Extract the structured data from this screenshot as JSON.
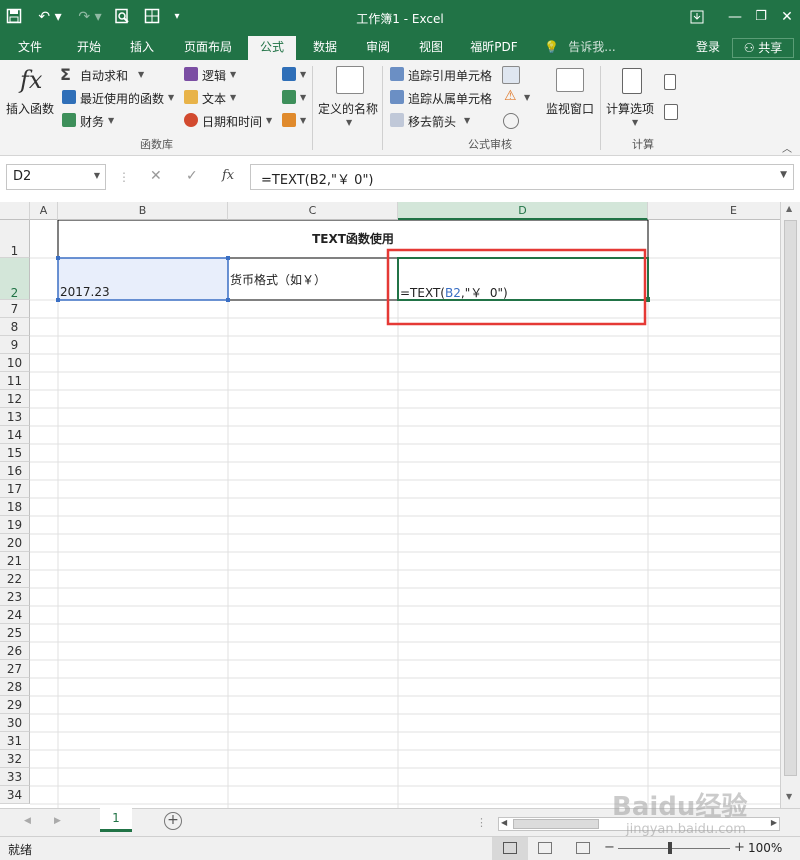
{
  "window": {
    "title": "工作簿1 - Excel"
  },
  "tabs": [
    "文件",
    "开始",
    "插入",
    "页面布局",
    "公式",
    "数据",
    "审阅",
    "视图",
    "福昕PDF"
  ],
  "active_tab": "公式",
  "tell_me": "告诉我...",
  "account": {
    "login": "登录",
    "share": "共享"
  },
  "ribbon": {
    "insert_function": "插入函数",
    "autosum": "自动求和",
    "recent": "最近使用的函数",
    "finance": "财务",
    "logic": "逻辑",
    "text": "文本",
    "datetime": "日期和时间",
    "defined_names": "定义的名称",
    "trace_precedents": "追踪引用单元格",
    "trace_dependents": "追踪从属单元格",
    "remove_arrows": "移去箭头",
    "watch_window": "监视窗口",
    "calc_options": "计算选项",
    "group_function_library": "函数库",
    "group_formula_auditing": "公式审核",
    "group_calculation": "计算"
  },
  "formula_bar": {
    "name_box": "D2",
    "formula": "=TEXT(B2,\"￥  0\")"
  },
  "columns": [
    "A",
    "B",
    "C",
    "D",
    "E"
  ],
  "rows": [
    "1",
    "2",
    "7",
    "8",
    "9",
    "10",
    "11",
    "12",
    "13",
    "14",
    "15",
    "16",
    "17",
    "18",
    "19",
    "20",
    "21",
    "22",
    "23",
    "24",
    "25",
    "26",
    "27",
    "28",
    "29",
    "30",
    "31",
    "32",
    "33",
    "34"
  ],
  "cells": {
    "title": "TEXT函数使用",
    "B2": "2017.23",
    "C2": "货币格式（如￥）",
    "D2_prefix": "=TEXT(",
    "D2_ref": "B2",
    "D2_suffix": ",\"￥  0\")"
  },
  "sheet_tab": "1",
  "status": {
    "ready": "就绪",
    "zoom": "100%"
  },
  "colors": {
    "excel_green": "#217346",
    "ref_blue": "#3a6fc4",
    "highlight_red": "#e53935"
  },
  "watermark": {
    "brand": "Baidu经验",
    "url": "jingyan.baidu.com"
  }
}
